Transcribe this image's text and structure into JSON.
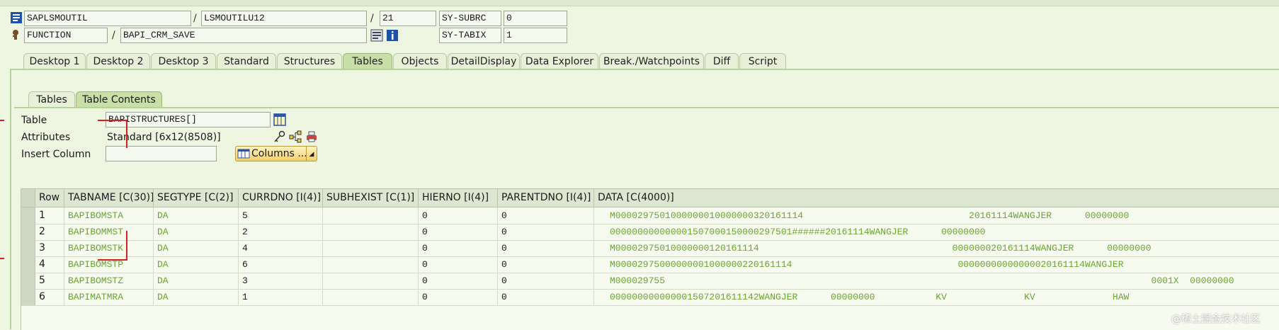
{
  "header": {
    "program": "SAPLSMOUTIL",
    "include": "LSMOUTILU12",
    "line": "21",
    "subrc_label": "SY-SUBRC",
    "subrc_value": "0",
    "event_type": "FUNCTION",
    "event_name": "BAPI_CRM_SAVE",
    "tabix_label": "SY-TABIX",
    "tabix_value": "1",
    "sep": "/"
  },
  "tabs": [
    "Desktop 1",
    "Desktop 2",
    "Desktop 3",
    "Standard",
    "Structures",
    "Tables",
    "Objects",
    "DetailDisplay",
    "Data Explorer",
    "Break./Watchpoints",
    "Diff",
    "Script"
  ],
  "active_tab": "Tables",
  "subtabs": [
    "Tables",
    "Table Contents"
  ],
  "form": {
    "table_label": "Table",
    "table_value": "BAPISTRUCTURES[]",
    "attributes_label": "Attributes",
    "attributes_value": "Standard [6x12(8508)]",
    "insert_column_label": "Insert Column",
    "insert_column_value": "",
    "columns_button": "Columns ..."
  },
  "grid": {
    "headers": [
      "Row",
      "TABNAME [C(30)]",
      "SEGTYPE [C(2)]",
      "CURRDNO [I(4)]",
      "SUBHEXIST [C(1)]",
      "HIERNO [I(4)]",
      "PARENTDNO [I(4)]",
      "DATA [C(4000)]"
    ],
    "rows": [
      {
        "row": "1",
        "tabname": "BAPIBOMSTA",
        "segtype": "DA",
        "currdno": "5",
        "subhexist": "",
        "hierno": "0",
        "parentdno": "0",
        "data": "M0000297501000000010000000320161114                              20161114WANGJER      00000000"
      },
      {
        "row": "2",
        "tabname": "BAPIBOMMST",
        "segtype": "DA",
        "currdno": "2",
        "subhexist": "",
        "hierno": "0",
        "parentdno": "0",
        "data": "000000000000001507000150000297501######20161114WANGJER      00000000"
      },
      {
        "row": "3",
        "tabname": "BAPIBOMSTK",
        "segtype": "DA",
        "currdno": "4",
        "subhexist": "",
        "hierno": "0",
        "parentdno": "0",
        "data": "M00002975010000000120161114                                   000000020161114WANGJER      00000000"
      },
      {
        "row": "4",
        "tabname": "BAPIBOMSTP",
        "segtype": "DA",
        "currdno": "6",
        "subhexist": "",
        "hierno": "0",
        "parentdno": "0",
        "data": "M00002975000000001000000220161114                              00000000000000020161114WANGJER"
      },
      {
        "row": "5",
        "tabname": "BAPIBOMSTZ",
        "segtype": "DA",
        "currdno": "3",
        "subhexist": "",
        "hierno": "0",
        "parentdno": "0",
        "data": "M000029755                                                                                        0001X  00000000"
      },
      {
        "row": "6",
        "tabname": "BAPIMATMRA",
        "segtype": "DA",
        "currdno": "1",
        "subhexist": "",
        "hierno": "0",
        "parentdno": "0",
        "data": "000000000000001507201611142WANGJER      00000000           KV              KV              HAW"
      }
    ]
  },
  "watermark": "@稀土掘金技术社区",
  "colors": {
    "background": "#eef5e1",
    "data_text": "#6aa431",
    "active_tab": "#c8e0a8",
    "annotation": "#d42020"
  }
}
